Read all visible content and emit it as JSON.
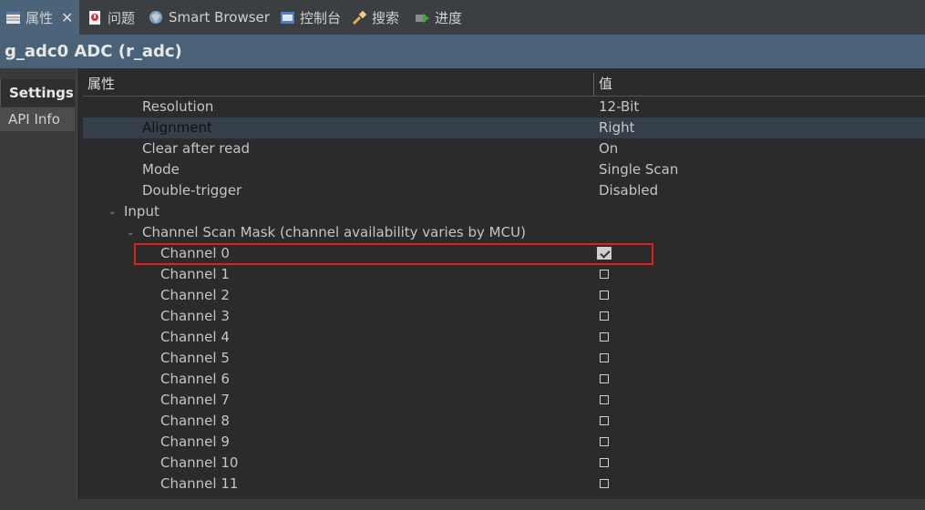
{
  "tabs": [
    {
      "label": "属性",
      "icon": "table-icon"
    },
    {
      "label": "问题",
      "icon": "problems-icon"
    },
    {
      "label": "Smart Browser",
      "icon": "smart-browser-icon"
    },
    {
      "label": "控制台",
      "icon": "console-icon"
    },
    {
      "label": "搜索",
      "icon": "search-icon"
    },
    {
      "label": "进度",
      "icon": "progress-icon"
    }
  ],
  "title": "g_adc0 ADC (r_adc)",
  "side_tabs": [
    "Settings",
    "API Info"
  ],
  "columns": {
    "property": "属性",
    "value": "值"
  },
  "rows": [
    {
      "label": "Resolution",
      "value": "12-Bit"
    },
    {
      "label": "Alignment",
      "value": "Right"
    },
    {
      "label": "Clear after read",
      "value": "On"
    },
    {
      "label": "Mode",
      "value": "Single Scan"
    },
    {
      "label": "Double-trigger",
      "value": "Disabled"
    }
  ],
  "group": "Input",
  "subgroup": "Channel Scan Mask (channel availability varies by MCU)",
  "channels": [
    {
      "label": "Channel 0",
      "checked": true
    },
    {
      "label": "Channel 1",
      "checked": false
    },
    {
      "label": "Channel 2",
      "checked": false
    },
    {
      "label": "Channel 3",
      "checked": false
    },
    {
      "label": "Channel 4",
      "checked": false
    },
    {
      "label": "Channel 5",
      "checked": false
    },
    {
      "label": "Channel 6",
      "checked": false
    },
    {
      "label": "Channel 7",
      "checked": false
    },
    {
      "label": "Channel 8",
      "checked": false
    },
    {
      "label": "Channel 9",
      "checked": false
    },
    {
      "label": "Channel 10",
      "checked": false
    },
    {
      "label": "Channel 11",
      "checked": false
    }
  ],
  "colors": {
    "highlight": "#e0201b",
    "selected_row": "#36404a",
    "title_bg": "#4a6277"
  }
}
